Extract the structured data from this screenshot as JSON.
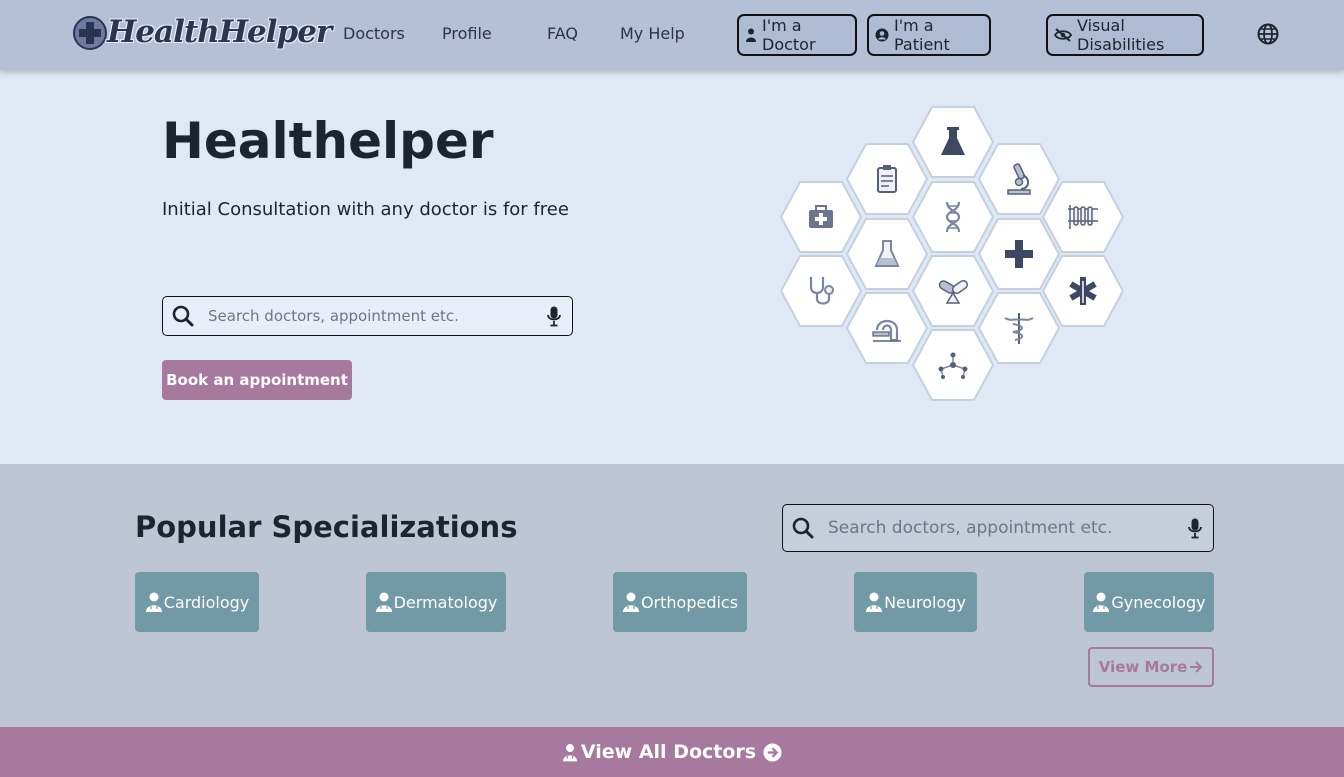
{
  "app": {
    "logo_text": "HealthHelper"
  },
  "nav": {
    "links": [
      "Doctors",
      "Profile",
      "FAQ",
      "My Help"
    ],
    "doctor_btn": "I'm a Doctor",
    "patient_btn": "I'm a Patient",
    "accessibility_btn": "Visual Disabilities"
  },
  "hero": {
    "title": "Healthelper",
    "subtitle": "Initial Consultation with any doctor is for free",
    "search_placeholder": "Search doctors, appointment etc.",
    "book_button": "Book an appointment"
  },
  "specializations": {
    "title": "Popular Specializations",
    "search_placeholder": "Search doctors, appointment etc.",
    "items": [
      "Cardiology",
      "Dermatology",
      "Orthopedics",
      "Neurology",
      "Gynecology"
    ],
    "view_more": "View More"
  },
  "footer_bar": {
    "label": "View All Doctors"
  },
  "colors": {
    "navbar": "#b3c0d6",
    "hero_bg": "#dfe8f5",
    "band_bg": "#bec6d5",
    "accent": "#a8799f",
    "spec_button": "#7199a6",
    "dark_text": "#1c2430"
  },
  "icons": {
    "hex_cluster": [
      "flask-icon",
      "clipboard-icon",
      "microscope-icon",
      "medkit-icon",
      "dna-icon",
      "test-tubes-icon",
      "beaker-icon",
      "medical-cross-icon",
      "stethoscope-icon",
      "pills-icon",
      "star-of-life-icon",
      "xray-machine-icon",
      "caduceus-icon",
      "molecule-icon"
    ]
  }
}
